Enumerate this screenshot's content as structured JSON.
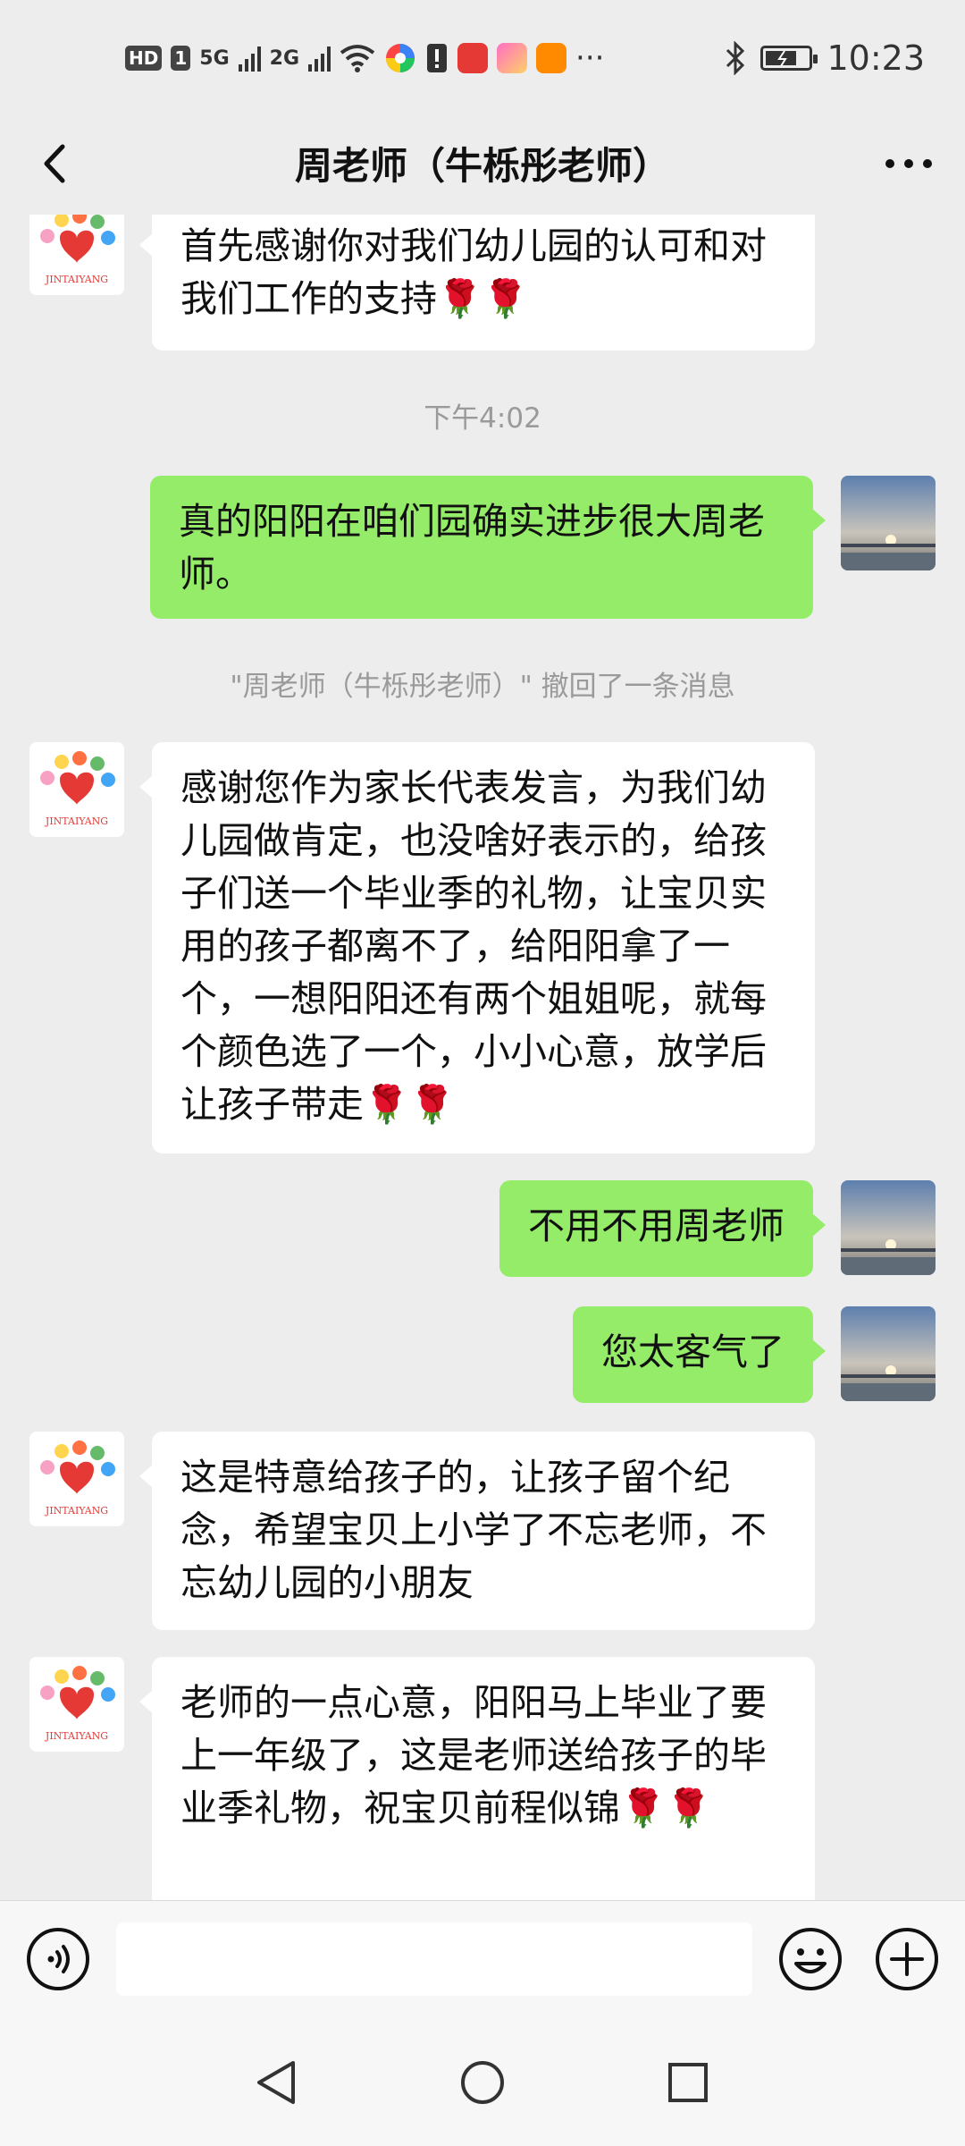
{
  "status_bar": {
    "time": "10:23",
    "network_5g": "5G",
    "network_2g": "2G",
    "hd": "HD",
    "sim": "1",
    "more_dots": "···"
  },
  "header": {
    "title": "周老师（牛栎彤老师）"
  },
  "messages": [
    {
      "side": "in",
      "text": "首先感谢你对我们幼儿园的认可和对我们工作的支持🌹🌹"
    },
    {
      "side": "out",
      "text": "真的阳阳在咱们园确实进步很大周老师。"
    },
    {
      "side": "in",
      "text": "感谢您作为家长代表发言，为我们幼儿园做肯定，也没啥好表示的，给孩子们送一个毕业季的礼物，让宝贝实用的孩子都离不了，给阳阳拿了一个，一想阳阳还有两个姐姐呢，就每个颜色选了一个，小小心意，放学后让孩子带走🌹🌹"
    },
    {
      "side": "out",
      "text": "不用不用周老师"
    },
    {
      "side": "out",
      "text": "您太客气了"
    },
    {
      "side": "in",
      "text": "这是特意给孩子的，让孩子留个纪念，希望宝贝上小学了不忘老师，不忘幼儿园的小朋友"
    },
    {
      "side": "in",
      "text": "老师的一点心意，阳阳马上毕业了要上一年级了，这是老师送给孩子的毕业季礼物，祝宝贝前程似锦🌹🌹"
    }
  ],
  "system": {
    "timestamp": "下午4:02",
    "recall_notice": "\"周老师（牛栎彤老师）\" 撤回了一条消息"
  },
  "avatar_logo_text": "JINTAIYANG",
  "colors": {
    "background": "#ededed",
    "bubble_out": "#95ec69",
    "bubble_in": "#ffffff"
  },
  "icons": [
    "back-icon",
    "more-icon",
    "voice-icon",
    "emoji-icon",
    "plus-icon",
    "nav-back-icon",
    "nav-home-icon",
    "nav-recent-icon"
  ]
}
